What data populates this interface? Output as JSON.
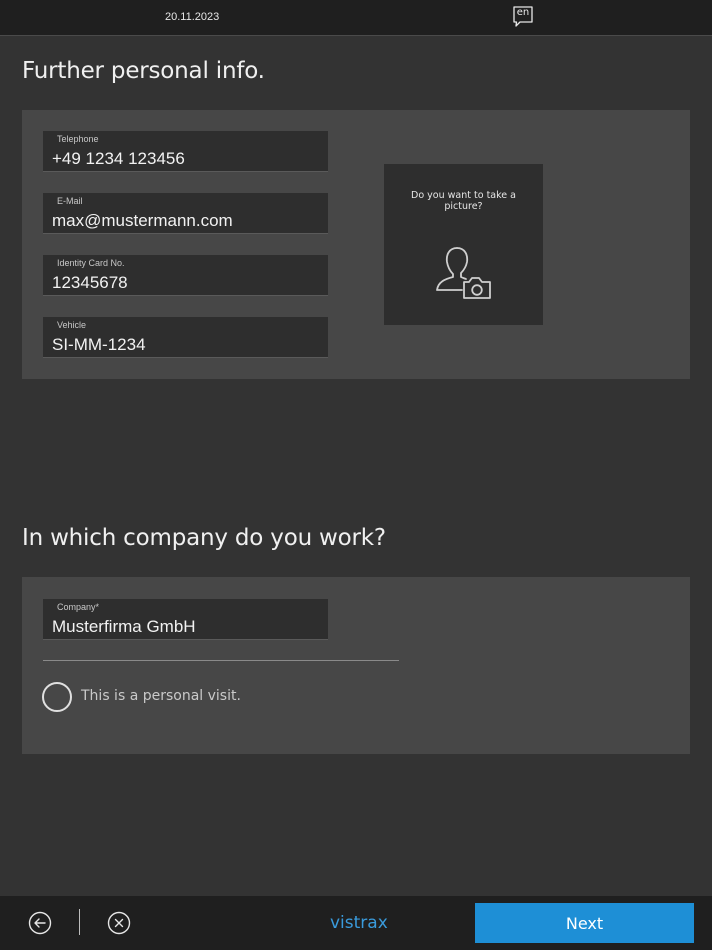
{
  "topbar": {
    "date": "20.11.2023",
    "language": "en"
  },
  "sections": {
    "personal_title": "Further personal info.",
    "company_title": "In which company do you work?"
  },
  "fields": {
    "telephone": {
      "label": "Telephone",
      "value": "+49 1234 123456"
    },
    "email": {
      "label": "E-Mail",
      "value": "max@mustermann.com"
    },
    "identity_card": {
      "label": "Identity Card No.",
      "value": "12345678"
    },
    "vehicle": {
      "label": "Vehicle",
      "value": "SI-MM-1234"
    },
    "company": {
      "label": "Company*",
      "value": "Musterfirma GmbH"
    }
  },
  "picture": {
    "prompt": "Do you want to take a picture?",
    "icon": "person-camera-icon"
  },
  "personal_visit": {
    "label": "This is a personal visit.",
    "checked": false
  },
  "bottombar": {
    "back_icon": "arrow-left-circle-icon",
    "cancel_icon": "close-circle-icon",
    "brand": "vistrax",
    "next_label": "Next"
  },
  "colors": {
    "background": "#333333",
    "panel": "#474747",
    "field": "#2e2e2e",
    "bar": "#1f1f1f",
    "accent": "#1e8fd6",
    "brand": "#3a9bdc"
  }
}
